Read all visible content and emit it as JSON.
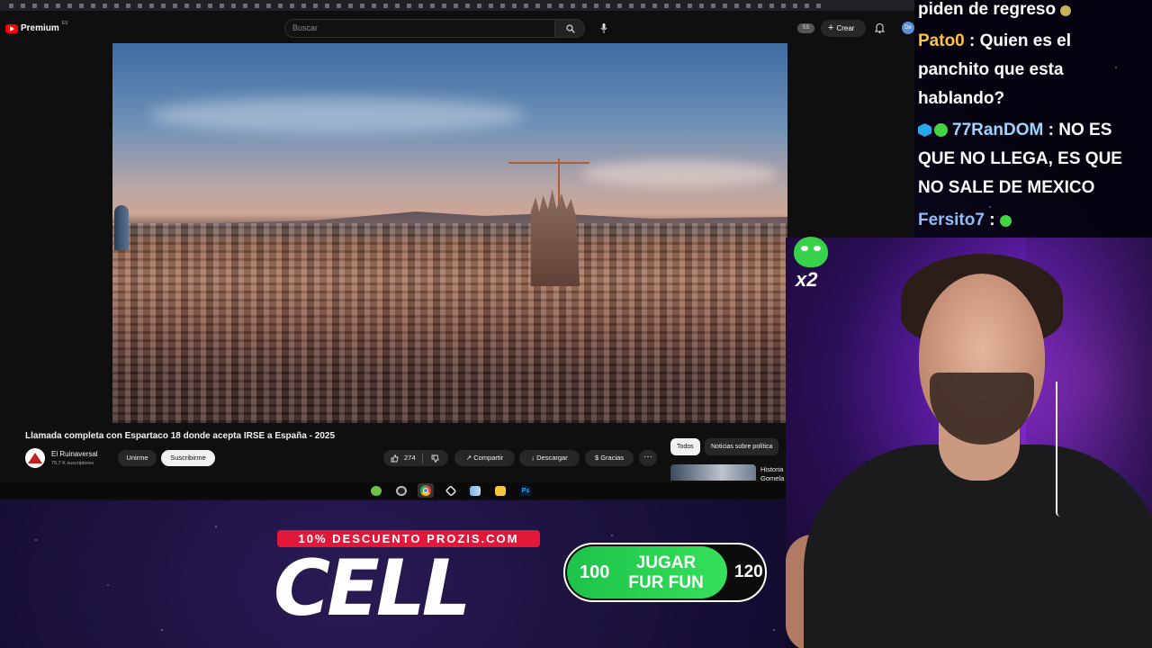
{
  "youtube": {
    "brand": "Premium",
    "country": "ES",
    "search_placeholder": "Buscar",
    "avatar_badge": "SS",
    "create_label": "Crear",
    "create_icon": "+",
    "user_avatar": "De",
    "video": {
      "title": "Llamada completa con Espartaco 18 donde acepta IRSE a España - 2025",
      "channel_name": "El Ruinaversal",
      "subscribers": "79,7 K suscriptores",
      "join_label": "Unirme",
      "subscribe_label": "Suscribirme",
      "like_count": "274",
      "share_label": "Compartir",
      "download_label": "Descargar",
      "thanks_label": "Gracias",
      "more_label": "···"
    },
    "chips": [
      "Todos",
      "Noticias sobre política"
    ],
    "recommended_title": "Historia Gomela"
  },
  "taskbar_icons": [
    "android-icon",
    "obs-icon",
    "chrome-icon",
    "capcut-icon",
    "app-icon",
    "folder-icon",
    "photoshop-icon"
  ],
  "taskbar_photoshop": "Ps",
  "chat": {
    "messages": [
      {
        "user": "",
        "text": "piden de regreso"
      },
      {
        "user": "Pato0",
        "text": ": Quien es el"
      },
      {
        "user": "",
        "text": "panchito que esta"
      },
      {
        "user": "",
        "text": "hablando?"
      },
      {
        "user": "77RanDOM",
        "text": ": NO ES"
      },
      {
        "user": "",
        "text": "QUE NO LLEGA, ES QUE"
      },
      {
        "user": "",
        "text": "NO SALE DE MEXICO"
      },
      {
        "user": "Fersito7",
        "text": ":"
      }
    ],
    "colors": {
      "pato": "#ffc43d",
      "random": "#9fd4ff",
      "fersito": "#8fbef5"
    }
  },
  "overlay": {
    "multiplier": "x2",
    "promo_code": "10% DESCUENTO PROZIS.COM",
    "brand": "CELL",
    "game_left": "100",
    "game_text": "JUGAR FUR FUN",
    "game_right": "120"
  }
}
